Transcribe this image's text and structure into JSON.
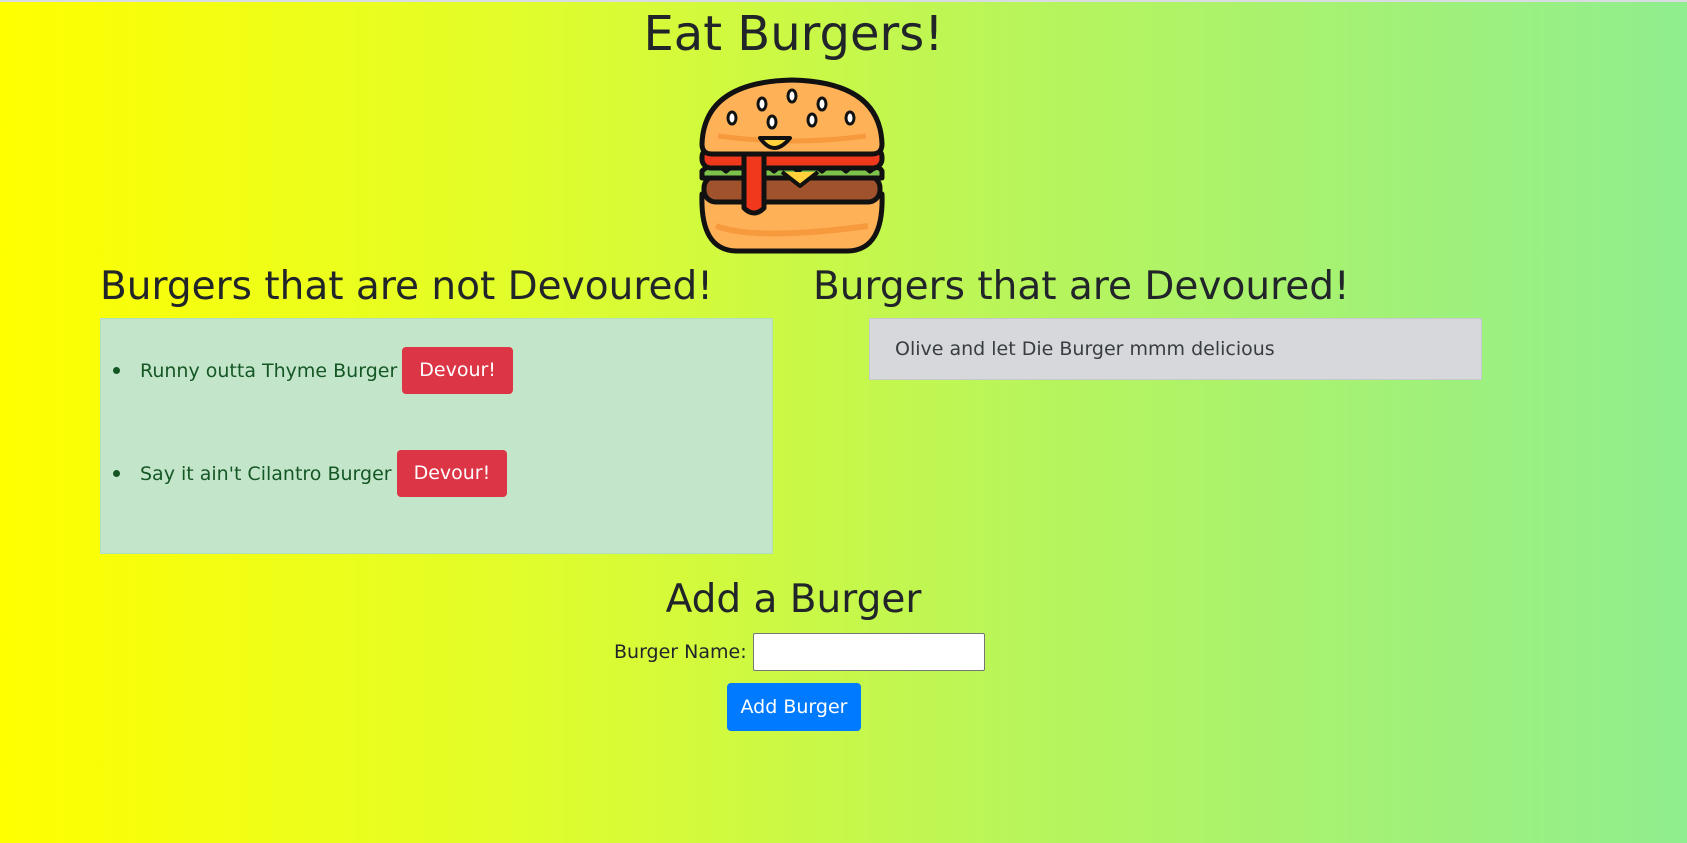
{
  "page": {
    "title": "Eat Burgers!",
    "background_colors": [
      "#ffff00",
      "#90ee8e"
    ]
  },
  "logo": {
    "icon": "burger-icon"
  },
  "not_devoured": {
    "heading": "Burgers that are not Devoured!",
    "box_color": "#c3e6cb",
    "items": [
      {
        "name": "Runny outta Thyme Burger",
        "button_label": "Devour!"
      },
      {
        "name": "Say it ain't Cilantro Burger",
        "button_label": "Devour!"
      }
    ]
  },
  "devoured": {
    "heading": "Burgers that are Devoured!",
    "box_color": "#d6d8db",
    "items": [
      {
        "name": "Olive and let Die Burger mmm delicious"
      }
    ]
  },
  "add_form": {
    "heading": "Add a Burger",
    "label": "Burger Name:",
    "input_value": "",
    "button_label": "Add Burger",
    "button_color": "#007bff"
  },
  "colors": {
    "devour_button": "#dc3545"
  }
}
